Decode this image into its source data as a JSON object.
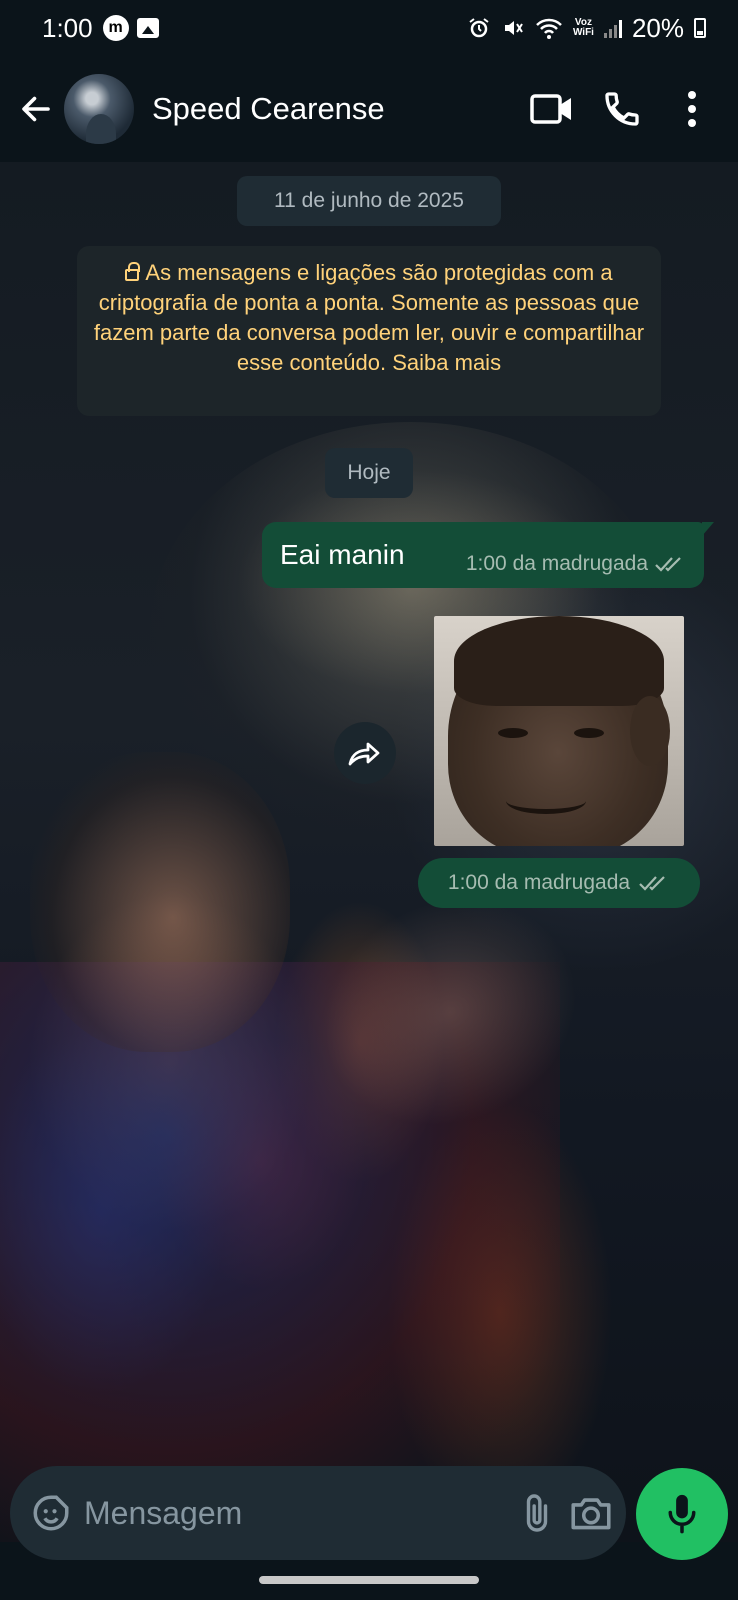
{
  "status_bar": {
    "time": "1:00",
    "app_icon_letter": "m",
    "voz_top": "Voz",
    "voz_bottom": "WiFi",
    "battery": "20%"
  },
  "header": {
    "contact_name": "Speed Cearense"
  },
  "chat": {
    "date_label": "11 de junho de 2025",
    "encryption_notice": "As mensagens e ligações são protegidas com a criptografia de ponta a ponta. Somente as pessoas que fazem parte da conversa podem ler, ouvir e compartilhar esse conteúdo. Saiba mais",
    "today_label": "Hoje",
    "messages": [
      {
        "text": "Eai manin",
        "time": "1:00 da madrugada",
        "status": "read"
      },
      {
        "type": "sticker",
        "time": "1:00 da madrugada",
        "status": "read"
      }
    ]
  },
  "composer": {
    "placeholder": "Mensagem"
  },
  "colors": {
    "background": "#0b141a",
    "outgoing_bubble": "#134d37",
    "mic_button": "#21c063",
    "notice_text": "#ffd27a"
  },
  "icons": [
    "back-arrow-icon",
    "video-call-icon",
    "phone-icon",
    "more-vert-icon",
    "lock-icon",
    "forward-icon",
    "double-check-icon",
    "emoji-sticker-icon",
    "attach-clip-icon",
    "camera-icon",
    "mic-icon"
  ]
}
